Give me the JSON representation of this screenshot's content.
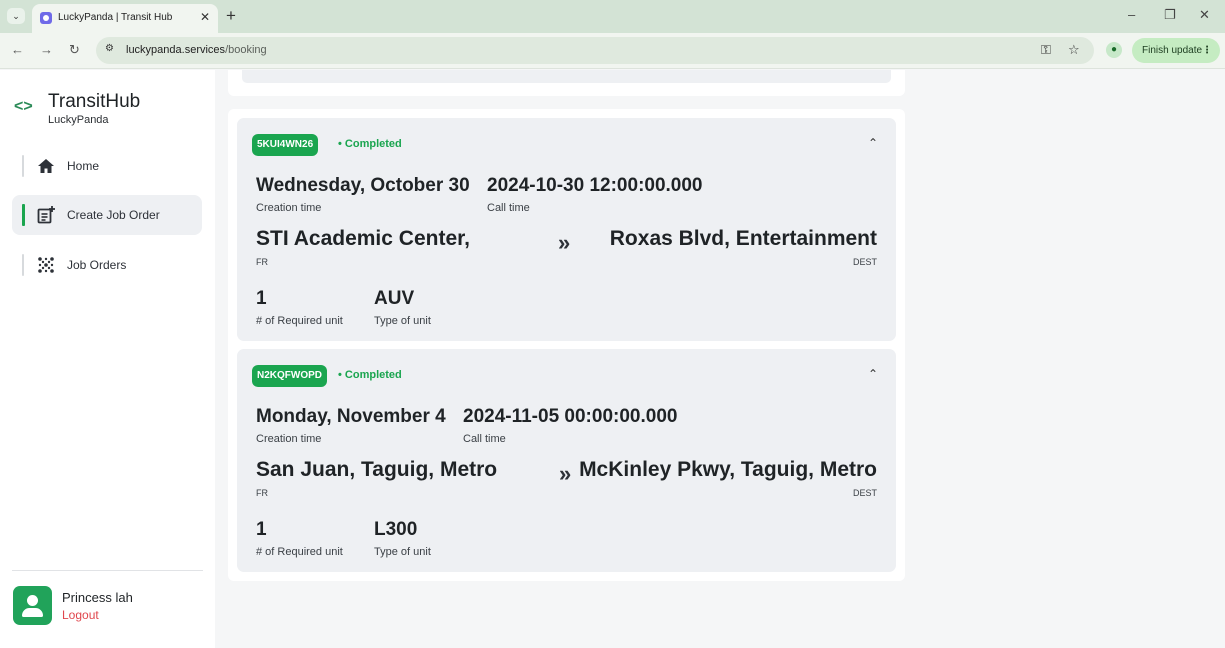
{
  "browser": {
    "tab_title": "LuckyPanda | Transit Hub",
    "url_domain": "luckypanda.services",
    "url_path": "/booking",
    "update_label": "Finish update"
  },
  "sidebar": {
    "brand_title": "TransitHub",
    "brand_subtitle": "LuckyPanda",
    "items": [
      {
        "label": "Home",
        "icon": "home-icon"
      },
      {
        "label": "Create Job Order",
        "icon": "create-job-order-icon"
      },
      {
        "label": "Job Orders",
        "icon": "job-orders-icon"
      }
    ],
    "user": {
      "name": "Princess lah",
      "logout_label": "Logout"
    }
  },
  "cards": [
    {
      "code": "5KUI4WN26",
      "status": "• Completed",
      "creation_date": "Wednesday, October 30",
      "creation_label": "Creation time",
      "call_time": "2024-10-30 12:00:00.000",
      "call_label": "Call time",
      "from": "STI Academic Center,",
      "from_label": "FR",
      "destination": "Roxas Blvd, Entertainment",
      "dest_label": "DEST",
      "required_units": "1",
      "required_units_label": "# of Required unit",
      "unit_type": "AUV",
      "unit_type_label": "Type of unit"
    },
    {
      "code": "N2KQFWOPD",
      "status": "• Completed",
      "creation_date": "Monday, November 4",
      "creation_label": "Creation time",
      "call_time": "2024-11-05 00:00:00.000",
      "call_label": "Call time",
      "from": "San Juan, Taguig, Metro",
      "from_label": "FR",
      "destination": "McKinley Pkwy, Taguig, Metro",
      "dest_label": "DEST",
      "required_units": "1",
      "required_units_label": "# of Required unit",
      "unit_type": "L300",
      "unit_type_label": "Type of unit"
    }
  ],
  "colors": {
    "accent": "#1aa54f",
    "logout": "#e0464d",
    "card_bg": "#eef0f3"
  }
}
